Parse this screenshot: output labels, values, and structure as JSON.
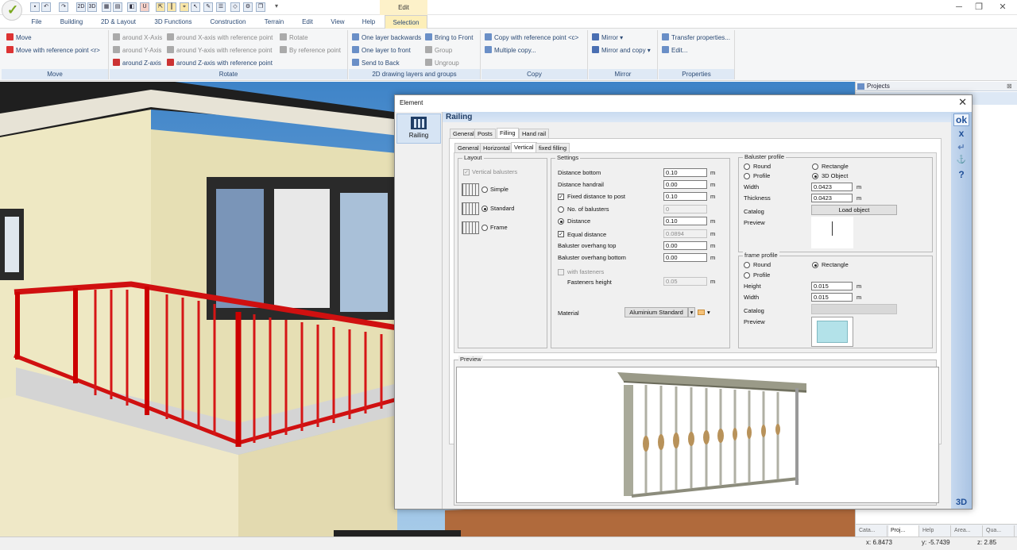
{
  "app": {
    "context_tab_title": "Edit"
  },
  "quick_access": [
    "2D",
    "3D"
  ],
  "tabs": [
    "File",
    "Building",
    "2D & Layout",
    "3D Functions",
    "Construction",
    "Terrain",
    "Edit",
    "View",
    "Help",
    "Selection"
  ],
  "ribbon": {
    "move": {
      "label": "Move",
      "items": [
        "Move",
        "Move with reference point <r>"
      ]
    },
    "rotate": {
      "label": "Rotate",
      "col1": [
        "around X-Axis",
        "around Y-Axis",
        "around Z-axis"
      ],
      "col2": [
        "around X-axis with reference point",
        "around Y-axis with reference point",
        "around Z-axis with reference point"
      ],
      "col3": [
        "Rotate",
        "By reference point"
      ]
    },
    "layers": {
      "label": "2D drawing layers and groups",
      "col1": [
        "One layer backwards",
        "One layer to front",
        "Send to Back"
      ],
      "col2": [
        "Bring to Front",
        "Group",
        "Ungroup"
      ]
    },
    "copy": {
      "label": "Copy",
      "items": [
        "Copy with reference point <c>",
        "Multiple copy..."
      ]
    },
    "mirror": {
      "label": "Mirror",
      "items": [
        "Mirror",
        "Mirror and copy"
      ]
    },
    "properties": {
      "label": "Properties",
      "items": [
        "Transfer properties...",
        "Edit..."
      ]
    }
  },
  "right_panel": {
    "title": "Projects",
    "tabs": [
      "Cata...",
      "Proj...",
      "Help",
      "Area...",
      "Qua..."
    ]
  },
  "status": {
    "x": "x: 6.8473",
    "y": "y: -5.7439",
    "z": "z: 2.85"
  },
  "dialog": {
    "title": "Element",
    "left_item": "Railing",
    "header": "Railing",
    "tabs": [
      "General",
      "Posts",
      "Filling",
      "Hand rail"
    ],
    "subtabs": [
      "General",
      "Horizontal",
      "Vertical",
      "fixed filling"
    ],
    "layout": {
      "legend": "Layout",
      "vertical_balusters": "Vertical balusters",
      "options": [
        "Simple",
        "Standard",
        "Frame"
      ],
      "selected": "Standard"
    },
    "settings": {
      "legend": "Settings",
      "distance_bottom": {
        "label": "Distance bottom",
        "value": "0.10",
        "unit": "m"
      },
      "distance_handrail": {
        "label": "Distance handrail",
        "value": "0.00",
        "unit": "m"
      },
      "fixed_distance": {
        "label": "Fixed distance to post",
        "value": "0.10",
        "unit": "m"
      },
      "no_balusters": {
        "label": "No. of balusters",
        "value": "0"
      },
      "distance": {
        "label": "Distance",
        "value": "0.10",
        "unit": "m"
      },
      "equal_distance": {
        "label": "Equal distance",
        "value": "0.0894",
        "unit": "m"
      },
      "overhang_top": {
        "label": "Baluster overhang top",
        "value": "0.00",
        "unit": "m"
      },
      "overhang_bottom": {
        "label": "Baluster overhang bottom",
        "value": "0.00",
        "unit": "m"
      },
      "with_fasteners": "with fasteners",
      "fasteners_height": {
        "label": "Fasteners height",
        "value": "0.05",
        "unit": "m"
      },
      "material": {
        "label": "Material",
        "value": "Aluminium Standard"
      }
    },
    "baluster_profile": {
      "legend": "Baluster profile",
      "round": "Round",
      "rectangle": "Rectangle",
      "profile": "Profile",
      "object3d": "3D Object",
      "width": {
        "label": "Width",
        "value": "0.0423",
        "unit": "m"
      },
      "thickness": {
        "label": "Thickness",
        "value": "0.0423",
        "unit": "m"
      },
      "catalog": "Catalog",
      "load_object": "Load object",
      "preview": "Preview"
    },
    "frame_profile": {
      "legend": "frame profile",
      "round": "Round",
      "rectangle": "Rectangle",
      "profile": "Profile",
      "height": {
        "label": "Height",
        "value": "0.015",
        "unit": "m"
      },
      "width": {
        "label": "Width",
        "value": "0.015",
        "unit": "m"
      },
      "catalog": "Catalog",
      "preview": "Preview"
    },
    "preview_label": "Preview",
    "side": {
      "ok": "ok",
      "cancel": "x",
      "threed": "3D"
    }
  }
}
